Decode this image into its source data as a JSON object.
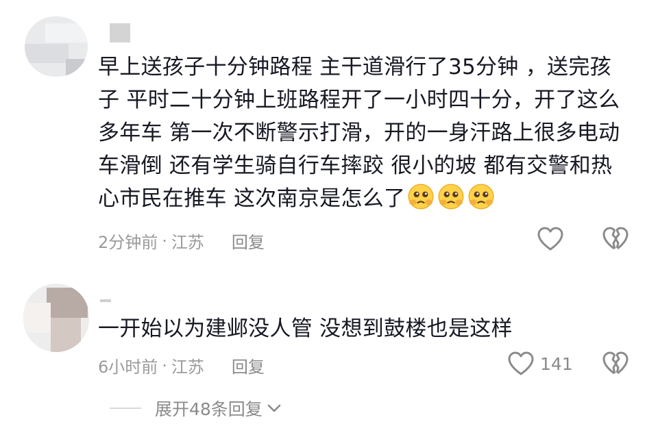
{
  "comments": [
    {
      "text": "早上送孩子十分钟路程 主干道滑行了35分钟 ，送完孩子 平时二十分钟上班路程开了一小时四十分，开了这么多年车 第一次不断警示打滑，开的一身汗路上很多电动车滑倒  还有学生骑自行车摔跤   很小的坡 都有交警和热心市民在推车  这次南京是怎么了",
      "emojis": [
        "crying-face-emoji",
        "crying-face-emoji",
        "crying-face-emoji"
      ],
      "time": "2分钟前",
      "separator": "·",
      "location": "江苏",
      "reply_label": "回复",
      "like_count": "",
      "like_icon": "heart-icon",
      "dislike_icon": "broken-heart-icon"
    },
    {
      "text": "一开始以为建邺没人管  没想到鼓楼也是这样",
      "time": "6小时前",
      "separator": "·",
      "location": "江苏",
      "reply_label": "回复",
      "like_count": "141",
      "like_icon": "heart-icon",
      "dislike_icon": "broken-heart-icon"
    }
  ],
  "expand_replies": {
    "label": "展开48条回复",
    "icon": "chevron-down-icon"
  },
  "colors": {
    "text": "#161823",
    "meta": "#9a9a9a",
    "icon": "#8a8a8a"
  }
}
